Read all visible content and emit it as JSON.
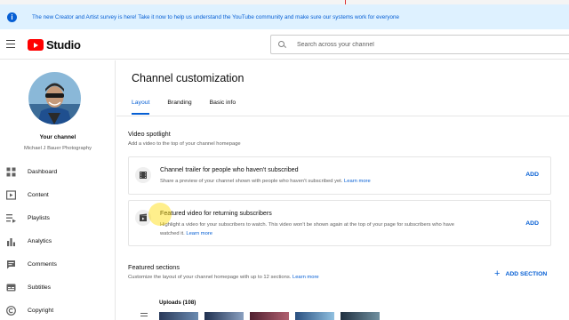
{
  "banner": {
    "text": "The new Creator and Artist survey is here! Take it now to help us understand the YouTube community and make sure our systems work for everyone"
  },
  "header": {
    "logo_text": "Studio",
    "search_placeholder": "Search across your channel"
  },
  "sidebar": {
    "your_channel": "Your channel",
    "channel_name": "Michael J Bauer Photography",
    "items": [
      {
        "label": "Dashboard",
        "icon": "dashboard-icon"
      },
      {
        "label": "Content",
        "icon": "content-icon"
      },
      {
        "label": "Playlists",
        "icon": "playlists-icon"
      },
      {
        "label": "Analytics",
        "icon": "analytics-icon"
      },
      {
        "label": "Comments",
        "icon": "comments-icon"
      },
      {
        "label": "Subtitles",
        "icon": "subtitles-icon"
      },
      {
        "label": "Copyright",
        "icon": "copyright-icon"
      }
    ]
  },
  "main": {
    "title": "Channel customization",
    "tabs": [
      {
        "label": "Layout"
      },
      {
        "label": "Branding"
      },
      {
        "label": "Basic info"
      }
    ],
    "video_spotlight": {
      "heading": "Video spotlight",
      "subtitle": "Add a video to the top of your channel homepage",
      "cards": [
        {
          "title": "Channel trailer for people who haven't subscribed",
          "desc": "Share a preview of your channel shown with people who haven't subscribed yet.",
          "link": "Learn more",
          "action": "ADD"
        },
        {
          "title": "Featured video for returning subscribers",
          "desc_line1": "Highlight a video for your subscribers to watch. This video won't be shown again at the top of your page for subscribers who have",
          "desc_line2": "watched it.",
          "link": "Learn more",
          "action": "ADD"
        }
      ]
    },
    "featured_sections": {
      "heading": "Featured sections",
      "subtitle": "Customize the layout of your channel homepage with up to 12 sections.",
      "link": "Learn more",
      "add_label": "ADD SECTION",
      "uploads_label": "Uploads (108)"
    }
  },
  "colors": {
    "accent": "#065fd4",
    "banner_bg": "#def1ff",
    "brand_red": "#ff0000"
  }
}
